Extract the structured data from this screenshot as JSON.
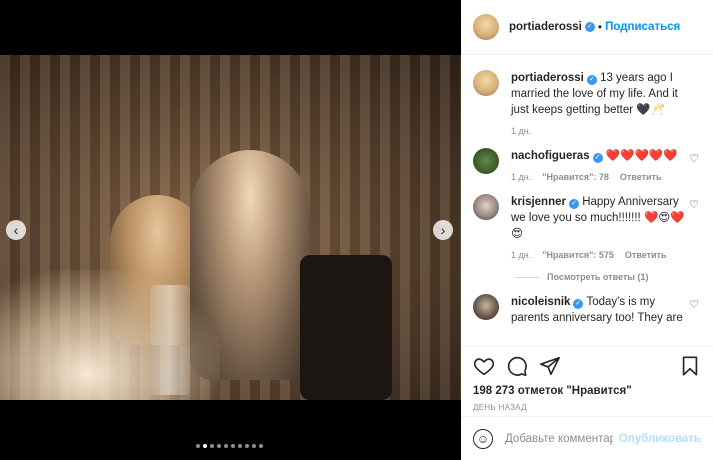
{
  "post": {
    "author": "portiaderossi",
    "follow_label": "Подписаться",
    "separator": "•",
    "caption": "13 years ago I married the love of my life. And it just keeps getting better 🖤🥂",
    "caption_time": "1 дн.",
    "likes": "198 273 отметок \"Нравится\"",
    "date": "ДЕНЬ НАЗАД",
    "carousel": {
      "total": 10,
      "active_index": 1
    }
  },
  "comments": [
    {
      "user": "nachofigueras",
      "verified": true,
      "text": "❤️❤️❤️❤️❤️",
      "time": "1 дн.",
      "likes": "\"Нравится\": 78",
      "reply_label": "Ответить"
    },
    {
      "user": "krisjenner",
      "verified": true,
      "text": "Happy Anniversary we love you so much!!!!!!! ❤️😍❤️😍",
      "time": "1 дн.",
      "likes": "\"Нравится\": 575",
      "reply_label": "Ответить",
      "view_replies": "Посмотреть ответы (1)"
    },
    {
      "user": "nicoleisnik",
      "verified": true,
      "text": "Today's is my parents anniversary too! They are"
    }
  ],
  "comment_input": {
    "placeholder": "Добавьте комментарий...",
    "publish_label": "Опубликовать"
  },
  "icons": {
    "heart": "heart-icon",
    "comment": "comment-icon",
    "share": "share-icon",
    "save": "bookmark-icon",
    "emoji": "smiley-icon",
    "prev": "chevron-left-icon",
    "next": "chevron-right-icon"
  },
  "colors": {
    "link": "#0095f6",
    "verified": "#3897f0",
    "muted": "#8e8e8e",
    "publish_disabled": "#b2dffc"
  }
}
